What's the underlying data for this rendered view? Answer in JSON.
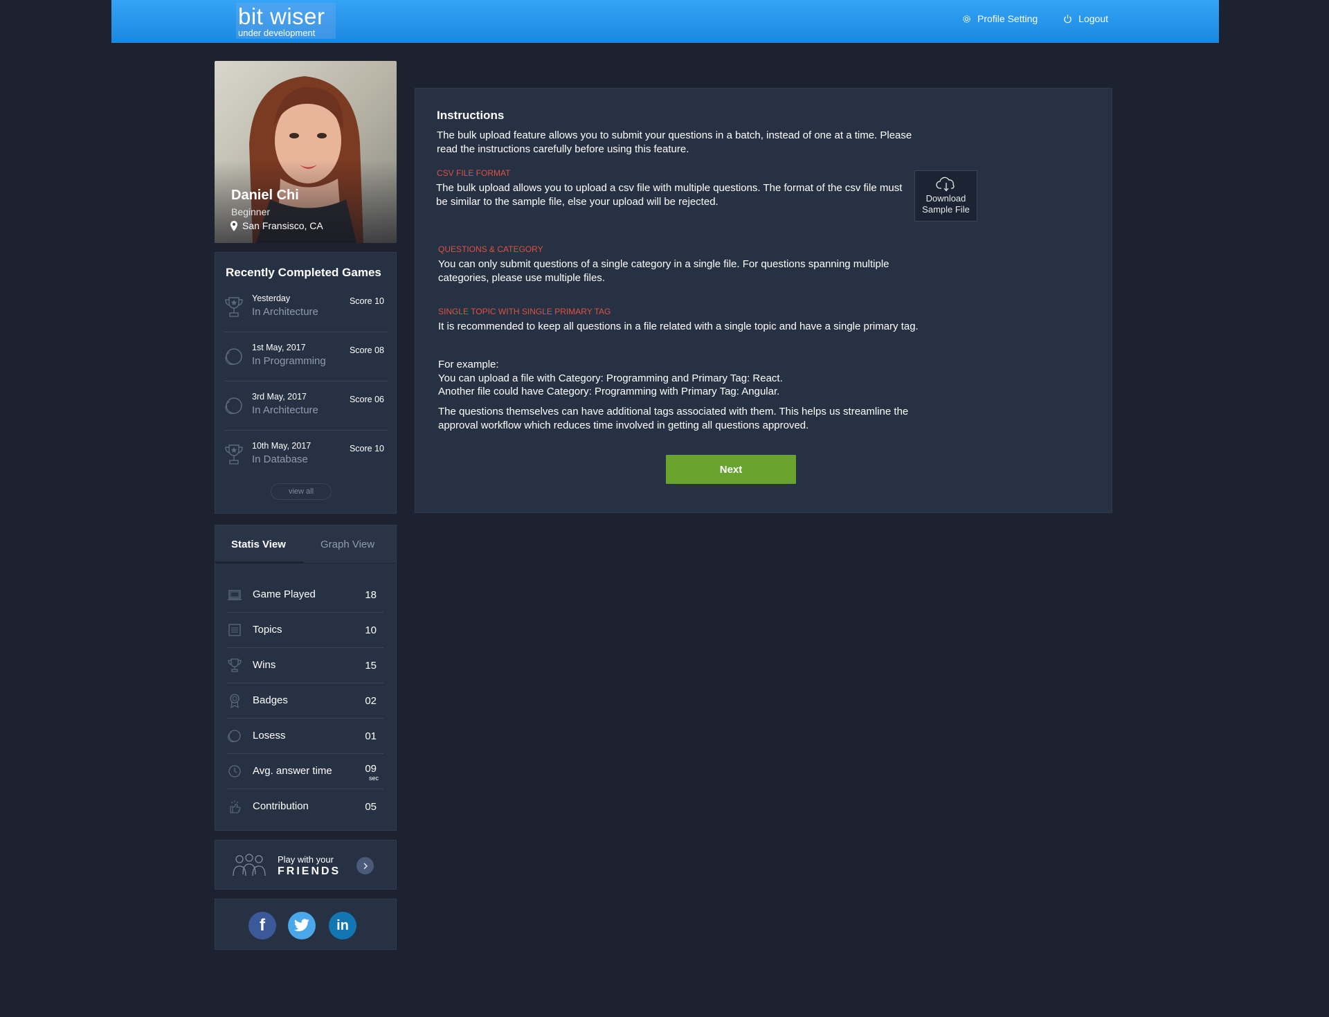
{
  "header": {
    "brand": "bit wiser",
    "brand_sub": "under development",
    "nav": {
      "profile_setting": "Profile Setting",
      "logout": "Logout"
    }
  },
  "profile": {
    "name": "Daniel Chi",
    "level": "Beginner",
    "location": "San Fransisco, CA"
  },
  "recent_games": {
    "title": "Recently Completed Games",
    "items": [
      {
        "date": "Yesterday",
        "category": "In Architecture",
        "score": "Score 10",
        "icon": "trophy-icon"
      },
      {
        "date": "1st May, 2017",
        "category": "In Programming",
        "score": "Score 08",
        "icon": "loss-circle-icon"
      },
      {
        "date": "3rd May, 2017",
        "category": "In Architecture",
        "score": "Score 06",
        "icon": "loss-circle-icon"
      },
      {
        "date": "10th May, 2017",
        "category": "In Database",
        "score": "Score 10",
        "icon": "trophy-icon"
      }
    ],
    "view_all": "view all"
  },
  "stats": {
    "tabs": {
      "active": "Statis View",
      "inactive": "Graph View"
    },
    "rows": [
      {
        "label": "Game Played",
        "value": "18",
        "icon": "laptop-icon"
      },
      {
        "label": "Topics",
        "value": "10",
        "icon": "list-icon"
      },
      {
        "label": "Wins",
        "value": "15",
        "icon": "trophy-icon"
      },
      {
        "label": "Badges",
        "value": "02",
        "icon": "badge-icon"
      },
      {
        "label": "Losess",
        "value": "01",
        "icon": "loss-circle-icon"
      },
      {
        "label": "Avg. answer time",
        "value": "09",
        "unit": "sec",
        "icon": "clock-icon"
      },
      {
        "label": "Contribution",
        "value": "05",
        "icon": "hand-icon"
      }
    ]
  },
  "friends": {
    "line1": "Play with your",
    "line2": "FRIENDS"
  },
  "social": {
    "facebook": "f",
    "linkedin": "in"
  },
  "instructions": {
    "title": "Instructions",
    "intro": "The bulk upload feature allows you to submit your questions in a batch, instead of one at a time. Please read the instructions carefully before using this feature.",
    "csv_head": "CSV FILE FORMAT",
    "csv_text": "The bulk upload allows you to upload a csv file with multiple questions. The format of the csv file must be similar to the sample file, else your upload will be rejected.",
    "download_line1": "Download",
    "download_line2": "Sample File",
    "cat_head": "QUESTIONS & CATEGORY",
    "cat_text": "You can only submit questions of a single category in a single file. For questions spanning multiple categories, please use multiple files.",
    "topic_head": "SINGLE TOPIC WITH SINGLE PRIMARY TAG",
    "topic_text": "It is recommended to keep all questions in a file related with a single topic and have a single primary tag.",
    "example_1": "For example:",
    "example_2": "You can upload a file with Category: Programming and Primary Tag: React.",
    "example_3": "Another file could have Category: Programming with Primary Tag: Angular.",
    "tags_text": "The questions themselves can have additional tags associated with them. This helps us streamline the approval workflow which reduces time involved in getting all questions approved.",
    "next": "Next"
  },
  "colors": {
    "header_blue": "#2196f3",
    "background": "#1c2230",
    "panel": "#263143",
    "accent_red": "#e0513f",
    "button_green": "#68a32d"
  }
}
